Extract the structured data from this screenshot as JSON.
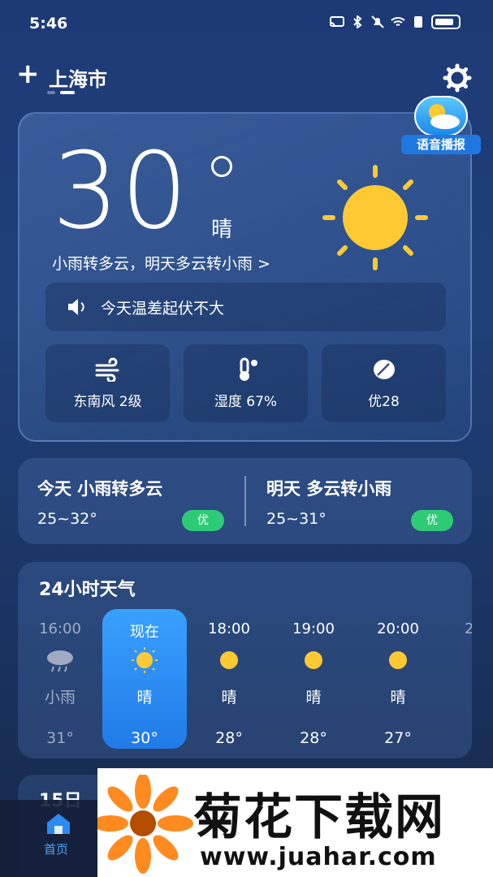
{
  "status_bar": {
    "time": "5:46"
  },
  "header": {
    "add_symbol": "+",
    "city": "上海市"
  },
  "voice_badge": {
    "label": "语音播报"
  },
  "current": {
    "temperature": "30",
    "condition": "晴",
    "summary": "小雨转多云，明天多云转小雨 >",
    "tip": "今天温差起伏不大",
    "tiles": [
      {
        "label": "东南风 2级",
        "icon": "wind-icon"
      },
      {
        "label": "湿度 67%",
        "icon": "thermometer-icon"
      },
      {
        "label": "优28",
        "icon": "leaf-icon"
      }
    ]
  },
  "days": [
    {
      "title": "今天  小雨转多云",
      "range": "25~32°",
      "aqi": "优"
    },
    {
      "title": "明天  多云转小雨",
      "range": "25~31°",
      "aqi": "优"
    }
  ],
  "hourly": {
    "title": "24小时天气",
    "items": [
      {
        "time": "16:00",
        "cond": "小雨",
        "temp": "31°",
        "icon": "rain-cloud-icon"
      },
      {
        "time": "现在",
        "cond": "晴",
        "temp": "30°",
        "icon": "sun-icon"
      },
      {
        "time": "18:00",
        "cond": "晴",
        "temp": "28°",
        "icon": "sun-icon"
      },
      {
        "time": "19:00",
        "cond": "晴",
        "temp": "28°",
        "icon": "sun-icon"
      },
      {
        "time": "20:00",
        "cond": "晴",
        "temp": "27°",
        "icon": "sun-icon"
      },
      {
        "time": "2",
        "cond": "",
        "temp": "",
        "icon": ""
      }
    ]
  },
  "next_section": {
    "title_fragment": "15日"
  },
  "nav": {
    "home": "首页"
  },
  "watermark": {
    "title": "菊花下载网",
    "url": "www.juahar.com"
  },
  "colors": {
    "accent": "#2a8bf2",
    "aqi_good": "#2ecb77",
    "sun": "#ffc933"
  }
}
